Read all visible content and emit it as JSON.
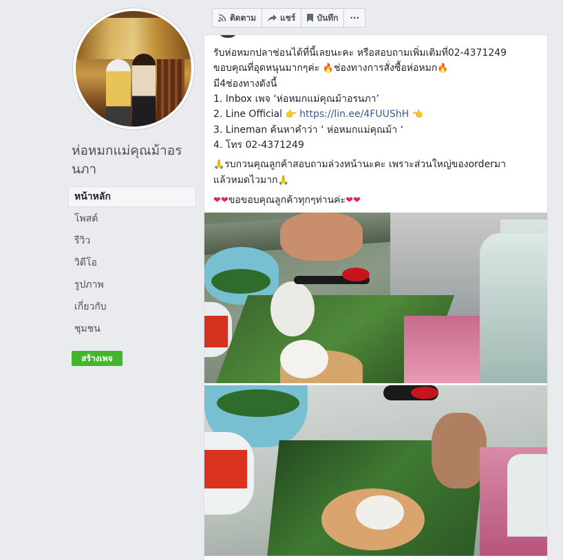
{
  "page": {
    "name": "ห่อหมกแม่คุณม้าอรนภา"
  },
  "nav": {
    "items": [
      {
        "label": "หน้าหลัก",
        "active": true
      },
      {
        "label": "โพสต์"
      },
      {
        "label": "รีวิว"
      },
      {
        "label": "วิดีโอ"
      },
      {
        "label": "รูปภาพ"
      },
      {
        "label": "เกี่ยวกับ"
      },
      {
        "label": "ชุมชน"
      }
    ],
    "create_page": "สร้างเพจ"
  },
  "actions": {
    "follow": "ติดตาม",
    "share": "แชร์",
    "save": "บันทึก",
    "more": "···"
  },
  "post": {
    "lines": {
      "l1": "รับห่อหมกปลาช่อนได้ที่นี้เลยนะคะ หรือสอบถามเพิ่มเติมที่02-4371249",
      "l2a": "ขอบคุณที่อุดหนุนมากๆค่ะ ",
      "l2b": "ช่องทางการสั่งซื้อห่อหมก",
      "l3": "มี4ช่องทางดังนี้",
      "l4": "1. Inbox เพจ ‘ห่อหมกแม่คุณม้าอรนภา’",
      "l5a": "2. Line Official ",
      "l5link": "https://lin.ee/4FUUShH",
      "l6": "3. Lineman ค้นหาคำว่า ‘ ห่อหมกแม่คุณม้า ‘",
      "l7": "4. โทร 02-4371249",
      "l8": "รบกวนคุณลูกค้าสอบถามล่วงหน้านะคะ เพราะส่วนใหญ่ของorderมา",
      "l9": "แล้วหมดไวมาก",
      "l10": "ขอขอบคุณลูกค้าทุกๆท่านค่ะ"
    },
    "emoji": {
      "fire": "🔥",
      "point_right": "👉",
      "point_left": "👈",
      "pray": "🙏",
      "heart": "❤"
    }
  },
  "colors": {
    "background": "#e9ebee",
    "link": "#385898",
    "create_button": "#42b72a",
    "fire": "#f36d1f",
    "heart": "#e0245e"
  }
}
